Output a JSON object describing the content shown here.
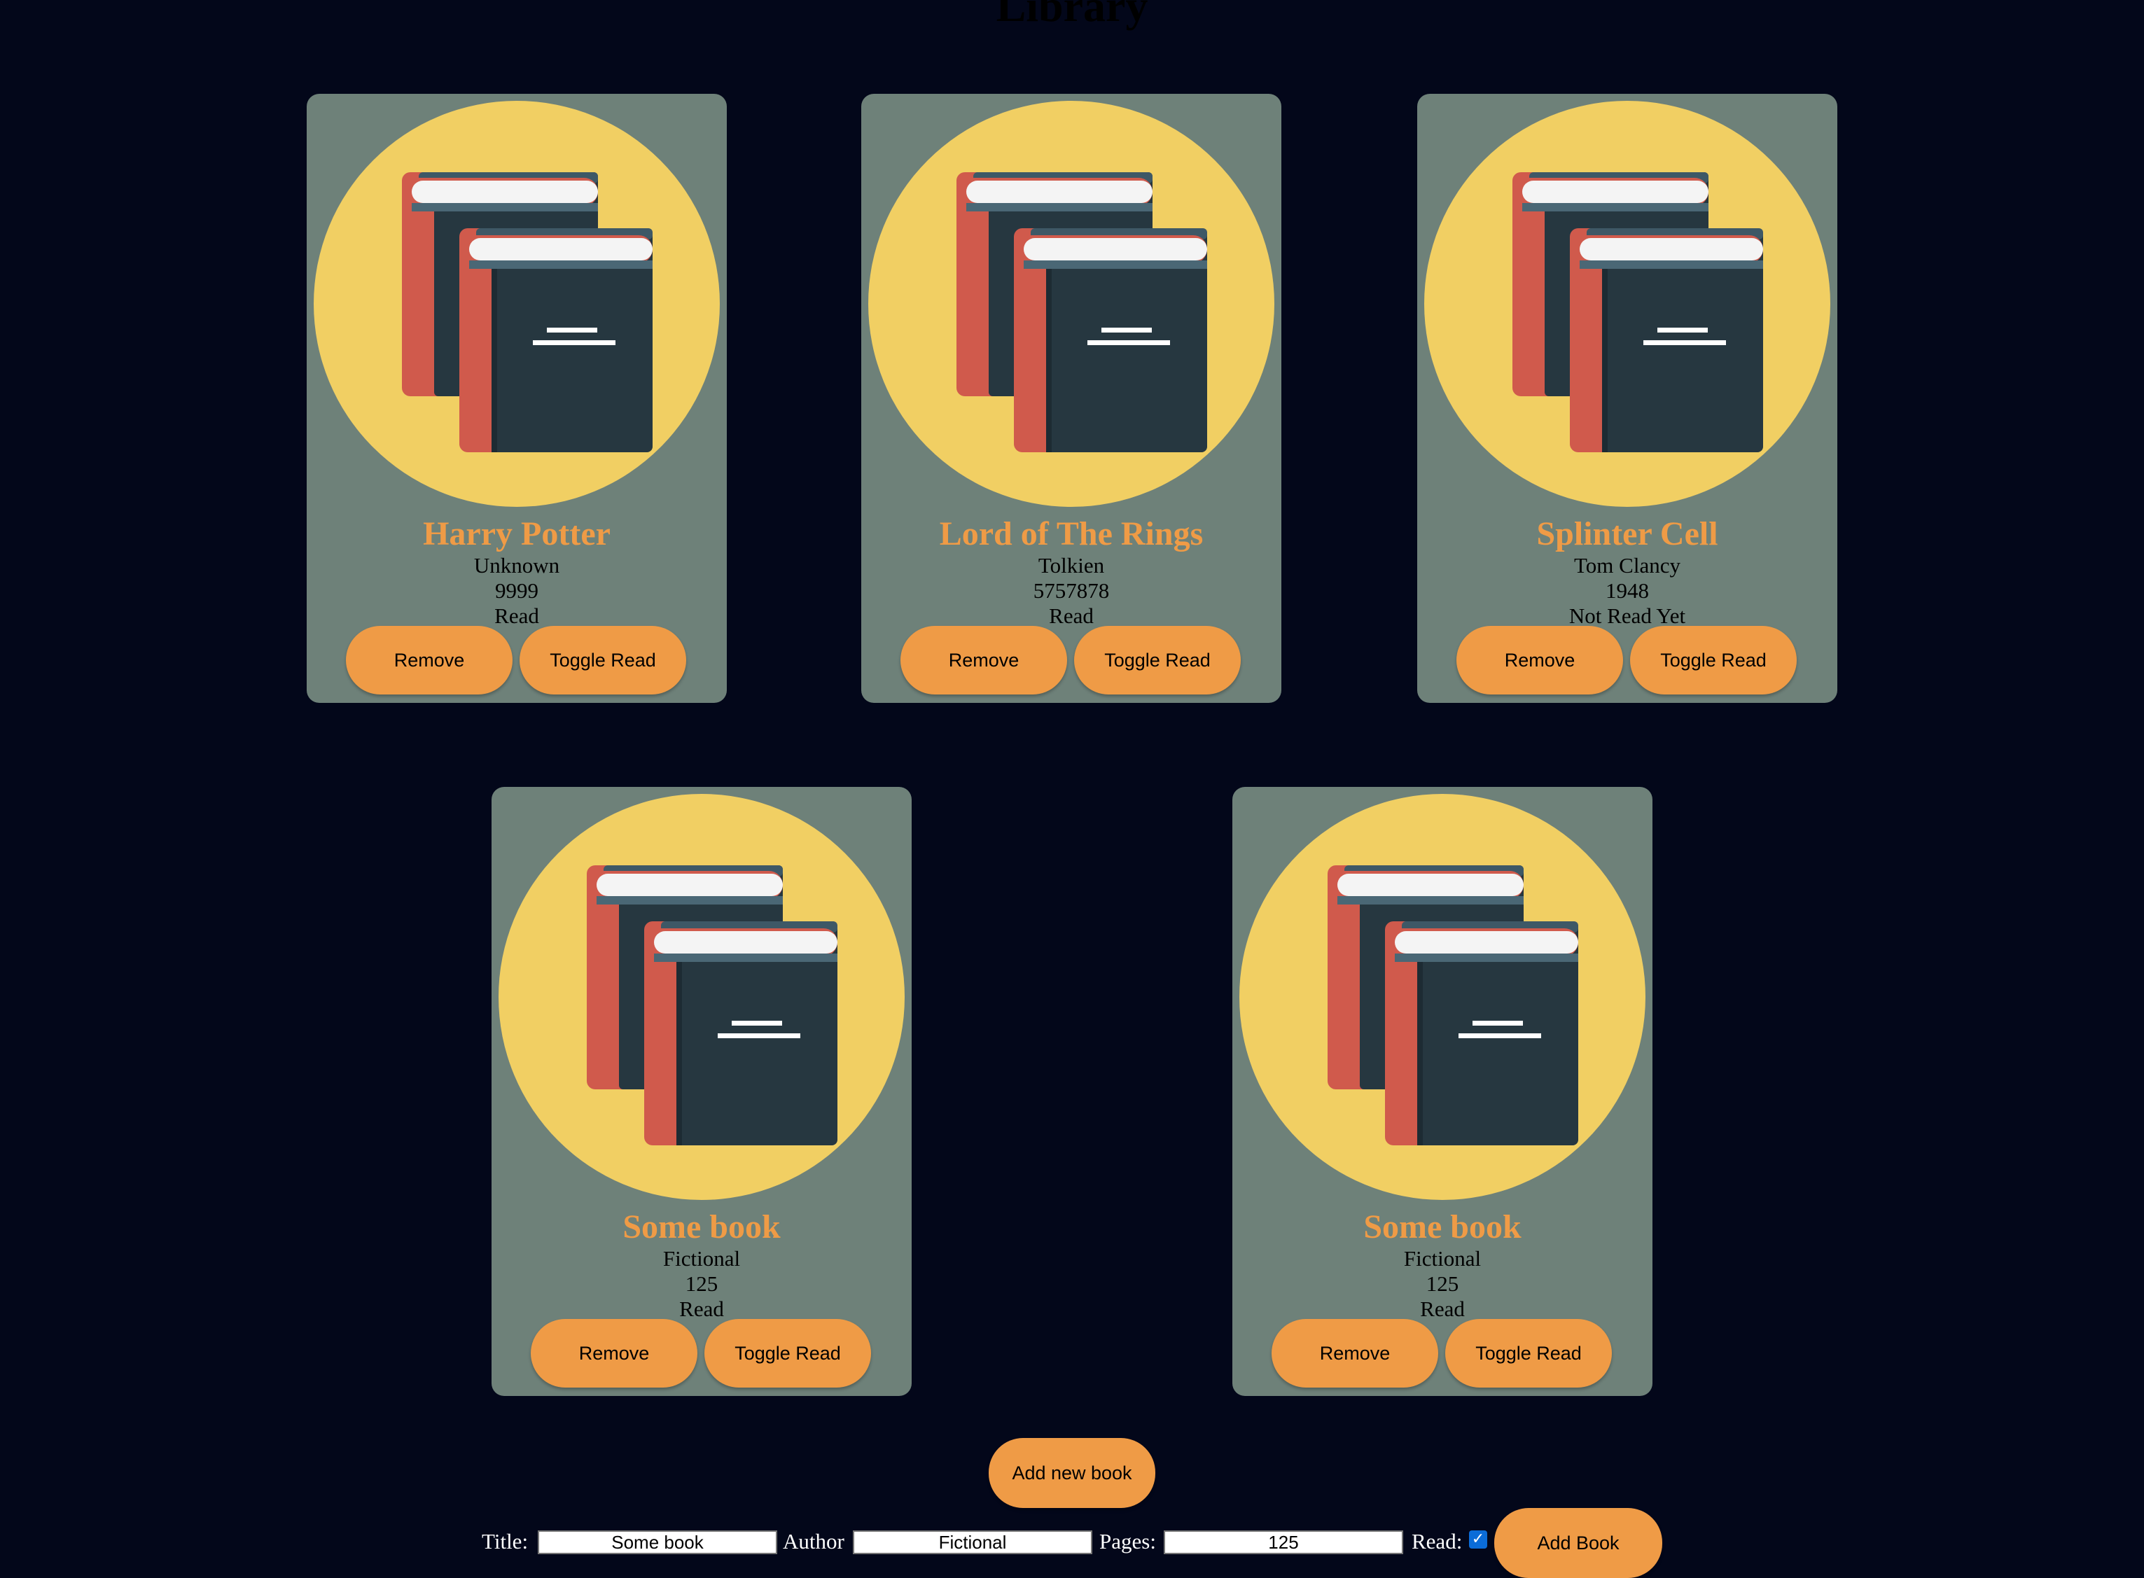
{
  "page": {
    "title": "Library"
  },
  "books": [
    {
      "title": "Harry Potter",
      "author": "Unknown",
      "pages": "9999",
      "status": "Read"
    },
    {
      "title": "Lord of The Rings",
      "author": "Tolkien",
      "pages": "5757878",
      "status": "Read"
    },
    {
      "title": "Splinter Cell",
      "author": "Tom Clancy",
      "pages": "1948",
      "status": "Not Read Yet"
    },
    {
      "title": "Some book",
      "author": "Fictional",
      "pages": "125",
      "status": "Read"
    },
    {
      "title": "Some book",
      "author": "Fictional",
      "pages": "125",
      "status": "Read"
    }
  ],
  "card_buttons": {
    "remove_label": "Remove",
    "toggle_label": "Toggle Read"
  },
  "add_new_button": {
    "label": "Add new book"
  },
  "form": {
    "title_label": "Title:",
    "title_value": "Some book",
    "author_label": "Author",
    "author_value": "Fictional",
    "pages_label": "Pages:",
    "pages_value": "125",
    "read_label": "Read:",
    "read_checked": true,
    "submit_label": "Add Book"
  },
  "colors": {
    "background": "#03071a",
    "card": "#6e8179",
    "cover": "#f1cf63",
    "accent": "#ef9b46"
  },
  "icons": {
    "book_cover": "stacked-books-icon",
    "checkbox": "check-icon"
  }
}
